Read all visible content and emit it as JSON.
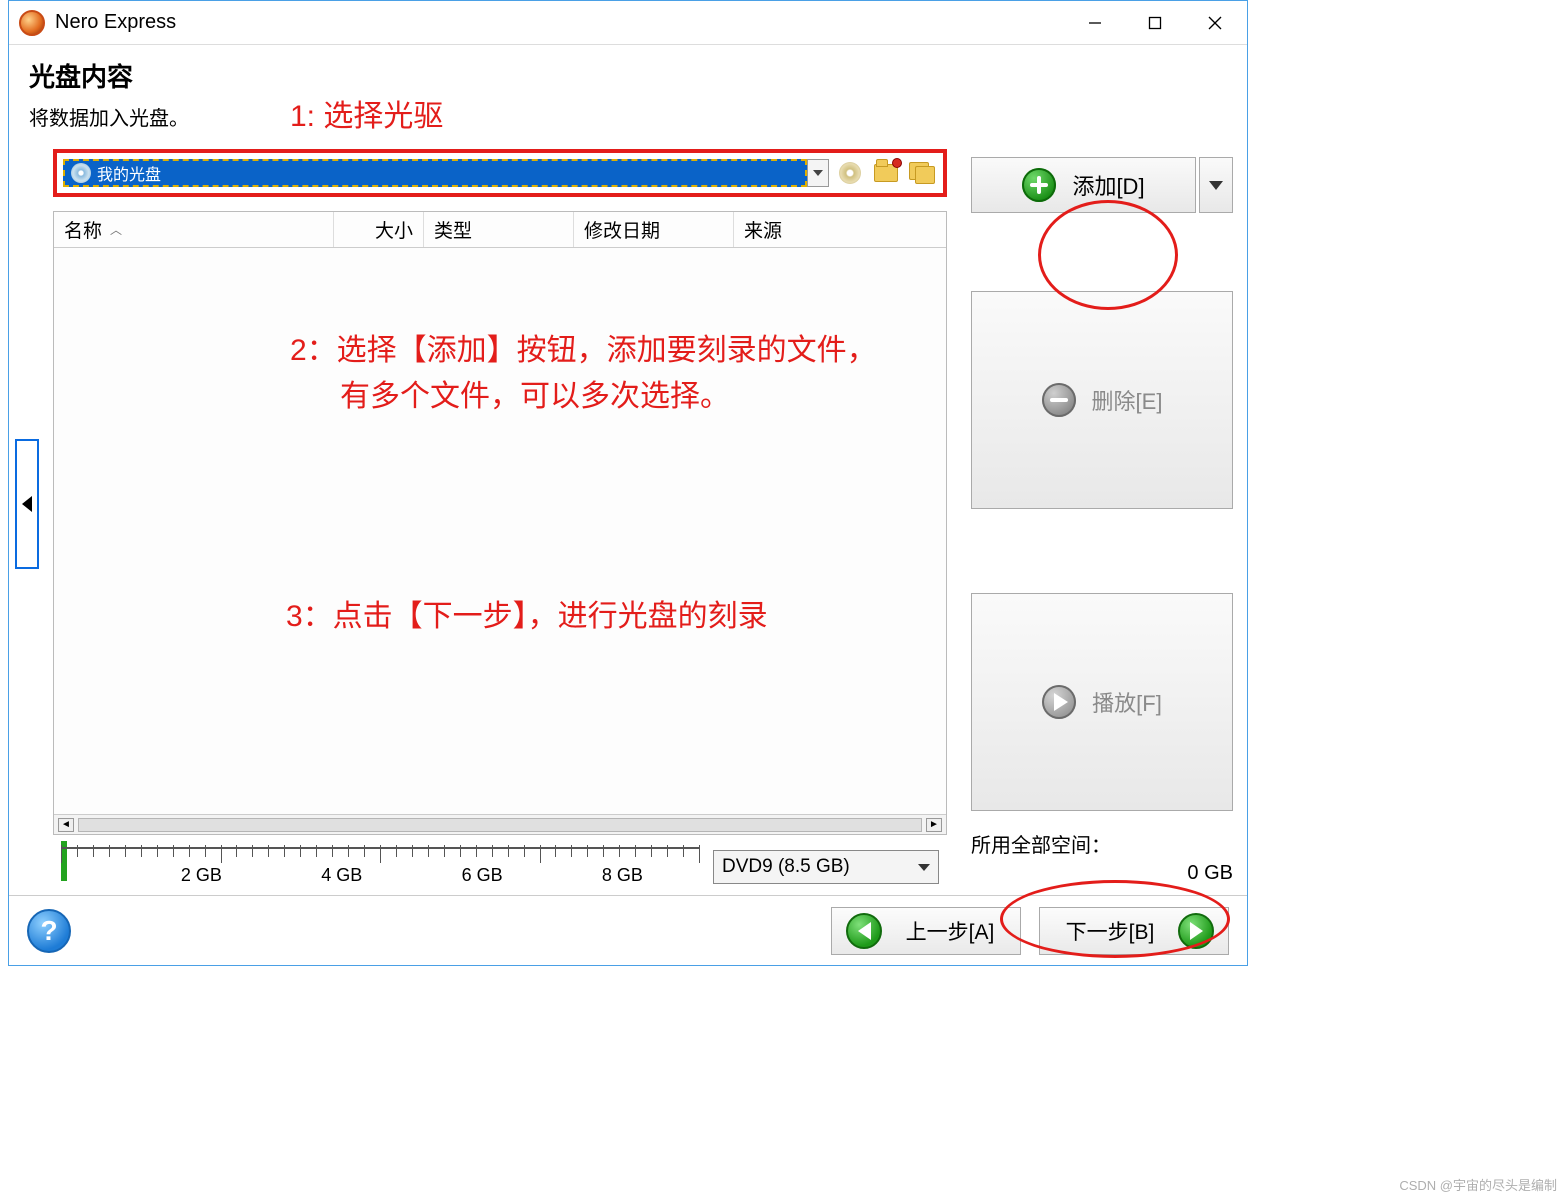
{
  "app": {
    "title": "Nero Express"
  },
  "header": {
    "title": "光盘内容",
    "subtitle": "将数据加入光盘。"
  },
  "drive": {
    "label": "我的光盘"
  },
  "table": {
    "columns": {
      "name": "名称",
      "size": "大小",
      "type": "类型",
      "date": "修改日期",
      "source": "来源"
    }
  },
  "sidebar": {
    "add": "添加[D]",
    "delete": "删除[E]",
    "play": "播放[F]"
  },
  "space": {
    "label": "所用全部空间：",
    "used": "0 GB"
  },
  "ruler": {
    "labels": [
      "2 GB",
      "4 GB",
      "6 GB",
      "8 GB"
    ]
  },
  "capacity": {
    "selected": "DVD9 (8.5 GB)"
  },
  "footer": {
    "back": "上一步[A]",
    "next": "下一步[B]"
  },
  "annotations": {
    "a1": "1: 选择光驱",
    "a2_line1": "2：选择【添加】按钮，添加要刻录的文件，",
    "a2_line2": "有多个文件，可以多次选择。",
    "a3": "3：点击【下一步】，进行光盘的刻录"
  },
  "watermark": "CSDN @宇宙的尽头是编制"
}
